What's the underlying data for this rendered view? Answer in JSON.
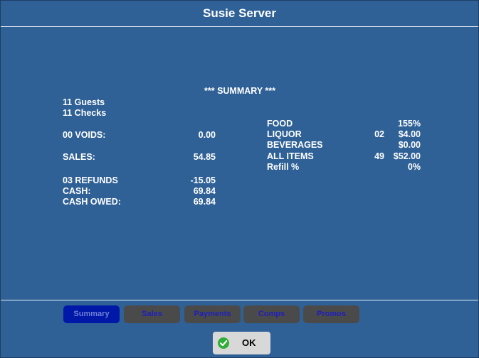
{
  "window": {
    "title": "Susie Server"
  },
  "summary": {
    "heading": "*** SUMMARY ***",
    "guests": "11 Guests",
    "checks": "11 Checks",
    "voids_label": "00 VOIDS:",
    "voids_value": "0.00",
    "sales_label": "SALES:",
    "sales_value": "54.85",
    "refunds_label": "03 REFUNDS",
    "refunds_value": "-15.05",
    "cash_label": "CASH:",
    "cash_value": "69.84",
    "cash_owed_label": "CASH OWED:",
    "cash_owed_value": "69.84"
  },
  "categories": [
    {
      "label": "FOOD",
      "count": "",
      "value": "155%"
    },
    {
      "label": "LIQUOR",
      "count": "02",
      "value": "$4.00"
    },
    {
      "label": "BEVERAGES",
      "count": "",
      "value": "$0.00"
    },
    {
      "label": "ALL ITEMS",
      "count": "49",
      "value": "$52.00"
    },
    {
      "label": "Refill %",
      "count": "",
      "value": "0%"
    }
  ],
  "tabs": [
    {
      "label": "Summary",
      "active": true
    },
    {
      "label": "Sales",
      "active": false
    },
    {
      "label": "Payments",
      "active": false
    },
    {
      "label": "Comps",
      "active": false
    },
    {
      "label": "Promos",
      "active": false
    }
  ],
  "ok_button": {
    "label": "OK",
    "icon": "checkmark-icon"
  },
  "colors": {
    "background": "#2f6197",
    "active_tab": "#0018a8",
    "inactive_tab": "#4a4a4a",
    "ok_icon": "#2fae3a"
  }
}
